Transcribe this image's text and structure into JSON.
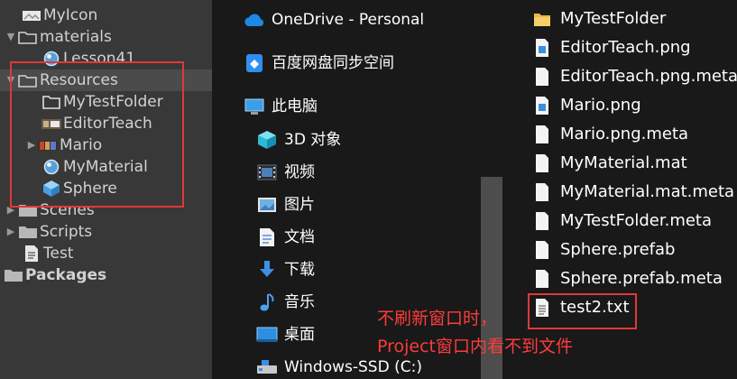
{
  "unity": {
    "items": [
      {
        "label": "MyIcon",
        "icon": "texture-icon"
      },
      {
        "label": "materials",
        "icon": "folder-open-icon",
        "arrow": "▼"
      },
      {
        "label": "Lesson41",
        "icon": "material-sphere-icon"
      },
      {
        "label": "Resources",
        "icon": "folder-open-icon",
        "arrow": "▼"
      },
      {
        "label": "MyTestFolder",
        "icon": "folder-empty-icon"
      },
      {
        "label": "EditorTeach",
        "icon": "sprite-icon"
      },
      {
        "label": "Mario",
        "icon": "sprite-icon",
        "arrow": "▶"
      },
      {
        "label": "MyMaterial",
        "icon": "material-sphere-icon"
      },
      {
        "label": "Sphere",
        "icon": "prefab-cube-icon"
      },
      {
        "label": "Scenes",
        "icon": "folder-icon",
        "arrow": "▶"
      },
      {
        "label": "Scripts",
        "icon": "folder-icon",
        "arrow": "▶"
      },
      {
        "label": "Test",
        "icon": "script-file-icon"
      },
      {
        "label": "Packages",
        "icon": "folder-icon",
        "arrow": "▶"
      }
    ]
  },
  "nav": {
    "items": [
      {
        "label": "OneDrive - Personal",
        "icon": "onedrive-cloud-icon"
      },
      {
        "label": "百度网盘同步空间",
        "icon": "baidu-netdisk-icon"
      },
      {
        "label": "此电脑",
        "icon": "this-pc-icon"
      },
      {
        "label": "3D 对象",
        "icon": "3d-objects-icon"
      },
      {
        "label": "视频",
        "icon": "videos-icon"
      },
      {
        "label": "图片",
        "icon": "pictures-icon"
      },
      {
        "label": "文档",
        "icon": "documents-icon"
      },
      {
        "label": "下载",
        "icon": "downloads-icon"
      },
      {
        "label": "音乐",
        "icon": "music-icon"
      },
      {
        "label": "桌面",
        "icon": "desktop-icon"
      },
      {
        "label": "Windows-SSD (C:)",
        "icon": "drive-icon"
      }
    ]
  },
  "files": {
    "items": [
      {
        "label": "MyTestFolder",
        "icon": "folder-icon"
      },
      {
        "label": "EditorTeach.png",
        "icon": "png-file-icon"
      },
      {
        "label": "EditorTeach.png.meta",
        "icon": "file-icon"
      },
      {
        "label": "Mario.png",
        "icon": "png-file-icon"
      },
      {
        "label": "Mario.png.meta",
        "icon": "file-icon"
      },
      {
        "label": "MyMaterial.mat",
        "icon": "file-icon"
      },
      {
        "label": "MyMaterial.mat.meta",
        "icon": "file-icon"
      },
      {
        "label": "MyTestFolder.meta",
        "icon": "file-icon"
      },
      {
        "label": "Sphere.prefab",
        "icon": "file-icon"
      },
      {
        "label": "Sphere.prefab.meta",
        "icon": "file-icon"
      },
      {
        "label": "test2.txt",
        "icon": "txt-file-icon"
      }
    ]
  },
  "annotation": {
    "line1": "不刷新窗口时，",
    "line2": "Project窗口内看不到文件"
  },
  "colors": {
    "highlight_red": "#e0383a",
    "note_red": "#ff3b3b"
  }
}
